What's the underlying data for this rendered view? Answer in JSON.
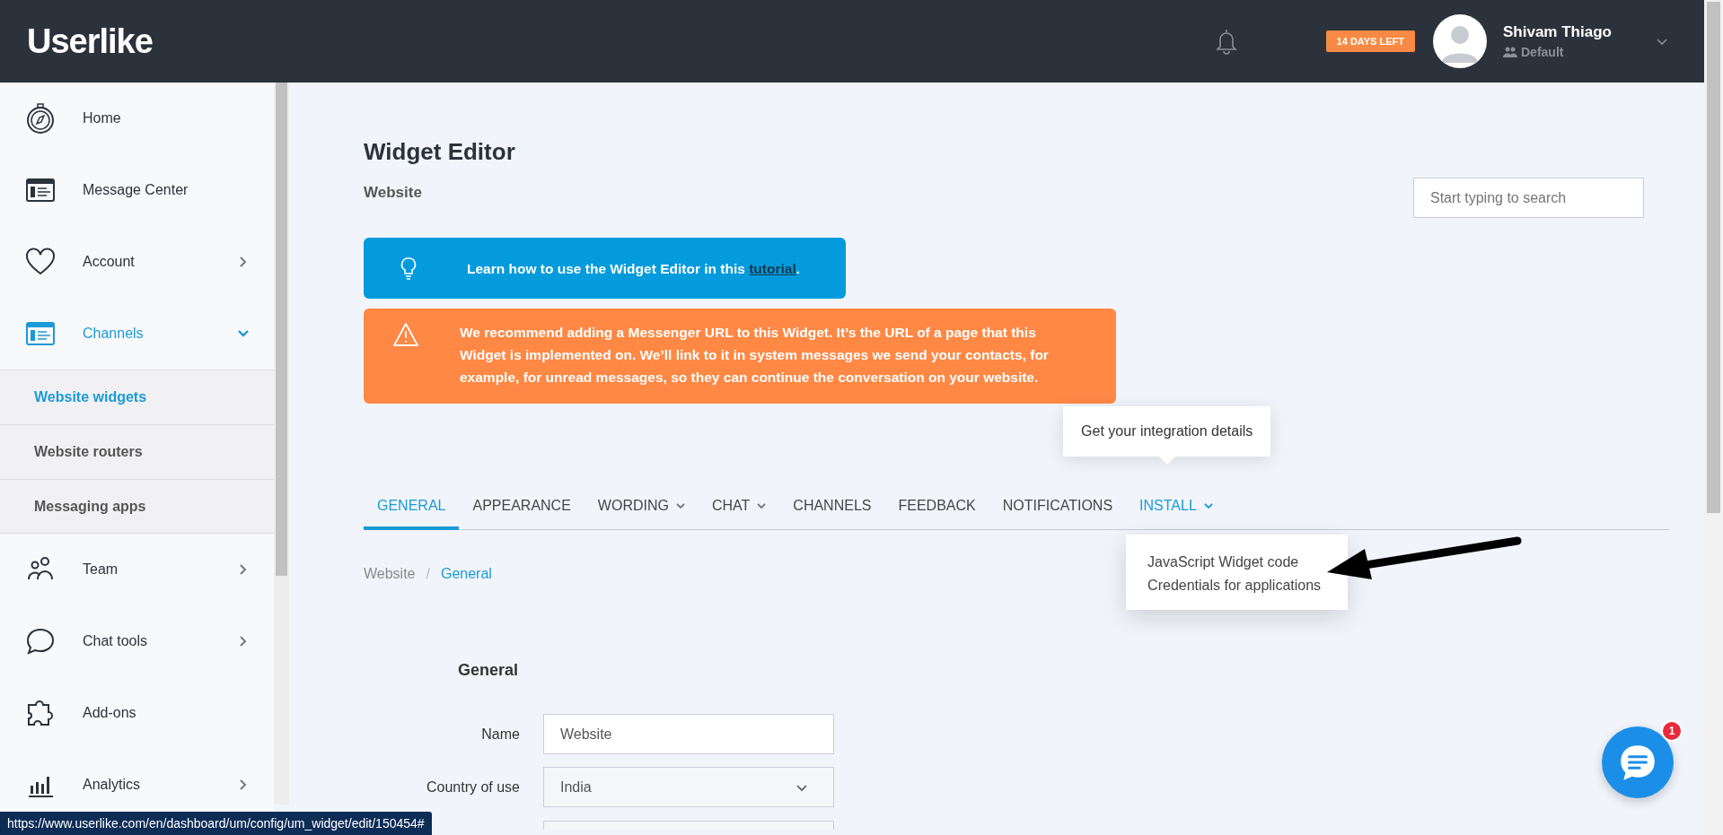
{
  "header": {
    "logo": "Userlike",
    "trial_badge": "14 DAYS LEFT",
    "user": {
      "name": "Shivam Thiago",
      "role": "Default"
    }
  },
  "sidebar": {
    "items": [
      {
        "label": "Home",
        "has_arrow": false,
        "selected": false
      },
      {
        "label": "Message Center",
        "has_arrow": false,
        "selected": false
      },
      {
        "label": "Account",
        "has_arrow": true,
        "expanded": false,
        "selected": false
      },
      {
        "label": "Channels",
        "has_arrow": true,
        "expanded": true,
        "selected": true,
        "children": [
          {
            "label": "Website widgets",
            "selected": true
          },
          {
            "label": "Website routers",
            "selected": false
          },
          {
            "label": "Messaging apps",
            "selected": false
          }
        ]
      },
      {
        "label": "Team",
        "has_arrow": true,
        "expanded": false,
        "selected": false
      },
      {
        "label": "Chat tools",
        "has_arrow": true,
        "expanded": false,
        "selected": false
      },
      {
        "label": "Add-ons",
        "has_arrow": false,
        "selected": false
      },
      {
        "label": "Analytics",
        "has_arrow": true,
        "expanded": false,
        "selected": false
      }
    ]
  },
  "page": {
    "title": "Widget Editor",
    "subtitle": "Website",
    "search": {
      "placeholder": "Start typing to search"
    }
  },
  "notices": [
    {
      "kind": "info",
      "text": "Learn how to use the Widget Editor in this ",
      "link": "tutorial",
      "after": "."
    },
    {
      "kind": "warning",
      "text": "We recommend adding a Messenger URL to this Widget. It’s the URL of a page that this Widget is implemented on. We’ll link to it in system messages we send your contacts, for example, for unread messages, so they can continue the conversation on your website."
    }
  ],
  "tabs": [
    {
      "label": "GENERAL",
      "has_caret": false,
      "selected": true,
      "open": false
    },
    {
      "label": "APPEARANCE",
      "has_caret": false,
      "selected": false,
      "open": false
    },
    {
      "label": "WORDING",
      "has_caret": true,
      "selected": false,
      "open": false
    },
    {
      "label": "CHAT",
      "has_caret": true,
      "selected": false,
      "open": false
    },
    {
      "label": "CHANNELS",
      "has_caret": false,
      "selected": false,
      "open": false
    },
    {
      "label": "FEEDBACK",
      "has_caret": false,
      "selected": false,
      "open": false
    },
    {
      "label": "NOTIFICATIONS",
      "has_caret": false,
      "selected": false,
      "open": false
    },
    {
      "label": "INSTALL",
      "has_caret": true,
      "selected": false,
      "open": true
    }
  ],
  "tooltip": "Get your integration details",
  "install_menu": [
    "JavaScript Widget code",
    "Credentials for applications"
  ],
  "breadcrumb": [
    {
      "label": "Website",
      "selected": false
    },
    {
      "label": "General",
      "selected": true
    }
  ],
  "breadcrumb_separator": "/",
  "form": {
    "section": "General",
    "fields": [
      {
        "kind": "text",
        "label": "Name",
        "value": "Website"
      },
      {
        "kind": "select",
        "label": "Country of use",
        "value": "India"
      }
    ]
  },
  "chat_button": {
    "badge": "1"
  },
  "status_bar": "https://www.userlike.com/en/dashboard/um/config/um_widget/edit/150454#"
}
